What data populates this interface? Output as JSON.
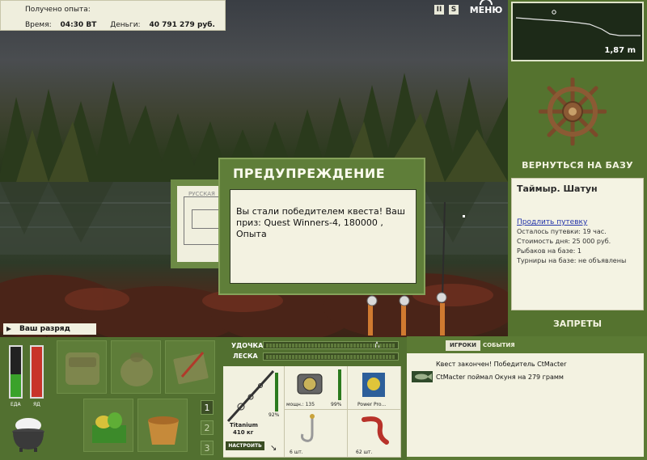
{
  "top_info": {
    "exp_label": "Получено опыта:",
    "time_label": "Время:",
    "time_value": "04:30 ВТ",
    "money_label": "Деньги:",
    "money_value": "40 791 279 руб."
  },
  "toolbar": {
    "pause_label": "II",
    "sound_label": "S",
    "menu_label": "МЕНЮ"
  },
  "minimap": {
    "depth": "1,87 m"
  },
  "right_panel": {
    "return_label": "ВЕРНУТЬСЯ НА БАЗУ",
    "bans_label": "ЗАПРЕТЫ"
  },
  "base_info": {
    "title": "Таймыр. Шатун",
    "extend_link": "Продлить путевку",
    "days_left": "Осталось путевки: 19 час.",
    "day_cost": "Стоимость дня: 25 000 руб.",
    "fishers": "Рыбаков на базе: 1",
    "tournaments": "Турниры на базе: не объявлены"
  },
  "background_window": {
    "label": "РУССКАЯ"
  },
  "dialog": {
    "title": "ПРЕДУПРЕЖДЕНИЕ",
    "body": "Вы стали победителем квеста! Ваш приз: Quest Winners-4, 180000 , Опыта"
  },
  "rank_message": "Ваш разряд вырос!",
  "meters": {
    "food_label": "ЕДА",
    "food_level": 0.45,
    "poison_label": "ЯД",
    "poison_level": 1.0
  },
  "inventory": {
    "pages": [
      "1",
      "2",
      "3"
    ],
    "active_page": "1"
  },
  "tension": {
    "rod_label": "УДОЧКА",
    "line_label": "ЛЕСКА"
  },
  "tackle": {
    "rod_name": "Titanium",
    "rod_weight": "410 кг",
    "rod_percent": "92%",
    "reel_info": "мощн.: 135",
    "reel_percent": "99%",
    "line_name": "Power Pro...",
    "hook_count": "6 шт.",
    "bait_count": "62 шт.",
    "setup_label": "НАСТРОИТЬ",
    "rod_condition": 0.92,
    "reel_condition": 0.99
  },
  "events": {
    "tab_players": "ИГРОКИ",
    "tab_events": "СОБЫТИЯ",
    "items": [
      "Квест закончен! Победитель CtMacter",
      "CtMacter поймал Окуня на 279 грамм"
    ]
  },
  "colors": {
    "panel_green": "#527030",
    "cream": "#f3f2e1",
    "food_green": "#3aa22a",
    "poison_red": "#c8332a"
  }
}
